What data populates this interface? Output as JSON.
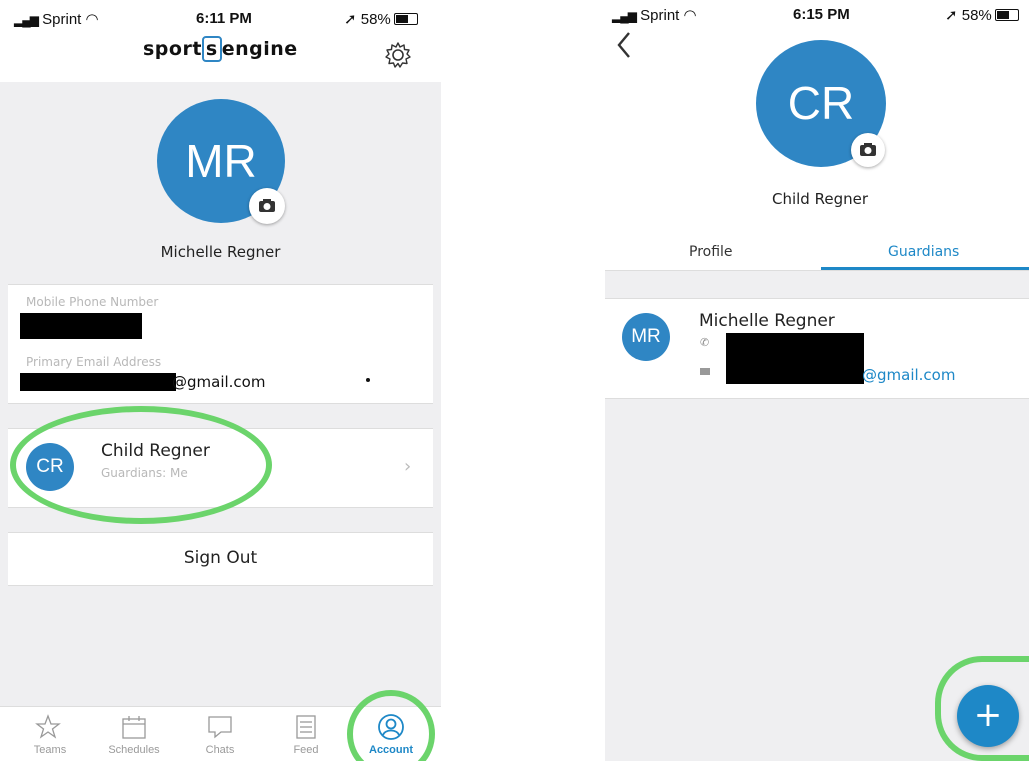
{
  "left_screen": {
    "status": {
      "carrier": "Sprint",
      "time": "6:11 PM",
      "battery": "58%"
    },
    "header": {
      "brand_part1": "sport",
      "brand_part2": "s",
      "brand_part3": "engine"
    },
    "profile": {
      "initials": "MR",
      "name": "Michelle Regner"
    },
    "contact": {
      "phone_label": "Mobile Phone Number",
      "email_label": "Primary Email Address",
      "email_suffix": "@gmail.com"
    },
    "child": {
      "initials": "CR",
      "name": "Child Regner",
      "subtitle": "Guardians: Me"
    },
    "sign_out": "Sign Out",
    "tabbar": [
      {
        "label": "Teams",
        "icon": "star-icon"
      },
      {
        "label": "Schedules",
        "icon": "calendar-icon"
      },
      {
        "label": "Chats",
        "icon": "chat-icon"
      },
      {
        "label": "Feed",
        "icon": "feed-icon"
      },
      {
        "label": "Account",
        "icon": "account-icon"
      }
    ]
  },
  "right_screen": {
    "status": {
      "carrier": "Sprint",
      "time": "6:15 PM",
      "battery": "58%"
    },
    "profile": {
      "initials": "CR",
      "name": "Child Regner"
    },
    "tabs": {
      "profile": "Profile",
      "guardians": "Guardians"
    },
    "guardian": {
      "initials": "MR",
      "name": "Michelle Regner",
      "email_suffix": "@gmail.com"
    },
    "fab": "+"
  },
  "colors": {
    "accent": "#2f86c4",
    "highlight": "#6bd46b",
    "tab_active": "#1e88c7"
  }
}
